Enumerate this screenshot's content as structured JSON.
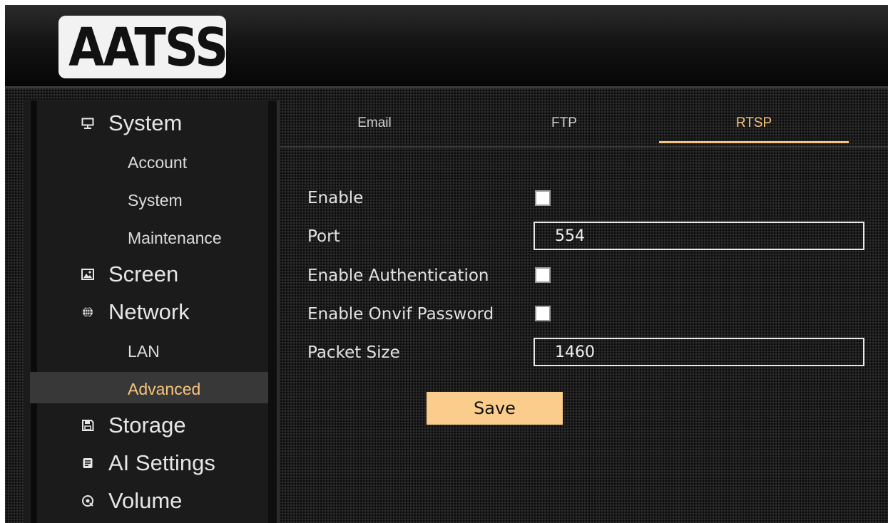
{
  "header": {
    "logo_text": "AATSS"
  },
  "sidebar": {
    "items": [
      {
        "label": "System",
        "type": "group",
        "icon": "monitor-icon"
      },
      {
        "label": "Account",
        "type": "sub"
      },
      {
        "label": "System",
        "type": "sub"
      },
      {
        "label": "Maintenance",
        "type": "sub"
      },
      {
        "label": "Screen",
        "type": "group",
        "icon": "image-icon"
      },
      {
        "label": "Network",
        "type": "group",
        "icon": "globe-icon"
      },
      {
        "label": "LAN",
        "type": "sub"
      },
      {
        "label": "Advanced",
        "type": "sub",
        "active": true
      },
      {
        "label": "Storage",
        "type": "group",
        "icon": "floppy-disk-icon"
      },
      {
        "label": "AI Settings",
        "type": "group",
        "icon": "ai-chip-icon"
      },
      {
        "label": "Volume",
        "type": "group",
        "icon": "volume-disc-icon"
      }
    ]
  },
  "tabs": [
    {
      "label": "Email",
      "active": false
    },
    {
      "label": "FTP",
      "active": false
    },
    {
      "label": "RTSP",
      "active": true
    }
  ],
  "form": {
    "enable_label": "Enable",
    "enable_checked": false,
    "port_label": "Port",
    "port_value": "554",
    "enable_auth_label": "Enable Authentication",
    "enable_auth_checked": false,
    "enable_onvif_label": "Enable Onvif Password",
    "enable_onvif_checked": false,
    "packet_size_label": "Packet Size",
    "packet_size_value": "1460",
    "save_label": "Save"
  },
  "colors": {
    "accent": "#f6c47e",
    "save_button": "#fbcd8c",
    "background": "#1c1c1c",
    "active_menu_bg": "#383838"
  }
}
